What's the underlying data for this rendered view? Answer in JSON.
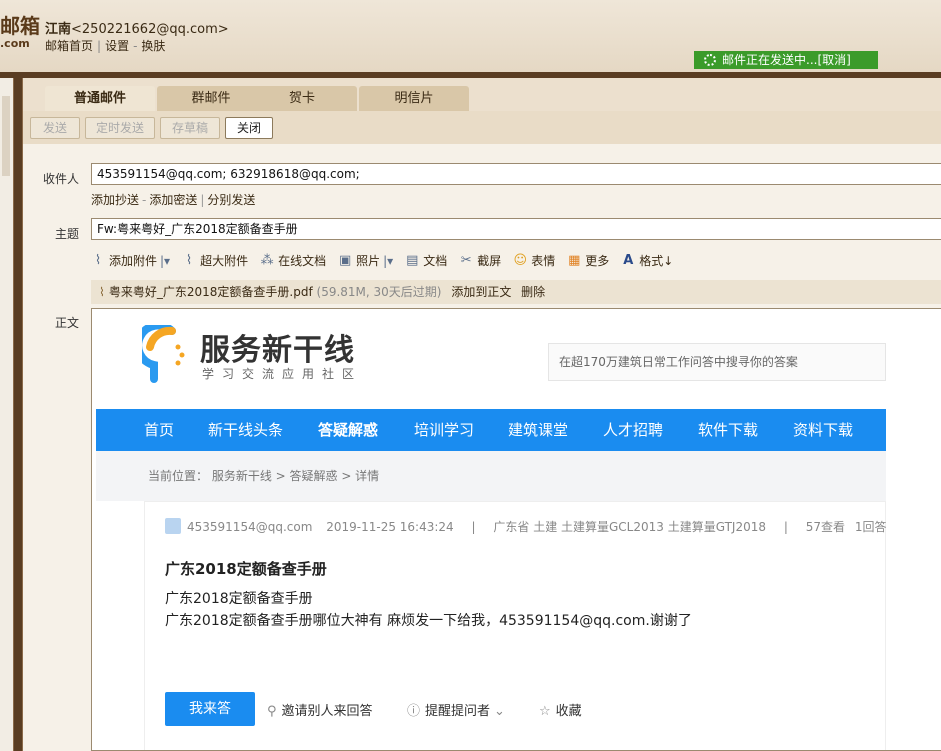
{
  "header": {
    "logo_text": "邮箱",
    "logo_sub": ".com",
    "user_name": "江南",
    "user_email": "<250221662@qq.com>",
    "links": [
      "邮箱首页",
      "设置",
      "换肤"
    ],
    "sending_status": "邮件正在发送中...",
    "cancel_label": "[取消]"
  },
  "tabs": [
    "普通邮件",
    "群邮件",
    "贺卡",
    "明信片"
  ],
  "toolbar_buttons": [
    "发送",
    "定时发送",
    "存草稿",
    "关闭"
  ],
  "compose": {
    "to_label": "收件人",
    "to_value": "453591154@qq.com; 632918618@qq.com;",
    "to_links": [
      "添加抄送",
      "添加密送",
      "分别发送"
    ],
    "subject_label": "主题",
    "subject_value": "Fw:粤来粤好_广东2018定额备查手册",
    "tools": [
      "添加附件",
      "超大附件",
      "在线文档",
      "照片",
      "文档",
      "截屏",
      "表情",
      "更多",
      "格式↓"
    ],
    "attachment": {
      "name": "粤来粤好_广东2018定额备查手册.pdf",
      "meta": "(59.81M, 30天后过期)",
      "add_label": "添加到正文",
      "delete_label": "删除"
    },
    "body_label": "正文"
  },
  "site": {
    "title": "服务新干线",
    "subtitle": "学习交流应用社区",
    "search_placeholder": "在超170万建筑日常工作问答中搜寻你的答案",
    "nav": [
      "首页",
      "新干线头条",
      "答疑解惑",
      "培训学习",
      "建筑课堂",
      "人才招聘",
      "软件下载",
      "资料下载"
    ],
    "breadcrumb": "当前位置：  服务新干线 > 答疑解惑 > 详情",
    "question": {
      "author": "453591154@qq.com",
      "date": "2019-11-25 16:43:24",
      "sep": "|",
      "tags": "广东省  土建 土建算量GCL2013 土建算量GTJ2018",
      "views": "57查看",
      "answers": "1回答",
      "title": "广东2018定额备查手册",
      "body_line1": "广东2018定额备查手册",
      "body_line2": "广东2018定额备查手册哪位大神有 麻烦发一下给我，453591154@qq.com.谢谢了",
      "answer_button": "我来答",
      "invite": "邀请别人来回答",
      "remind": "提醒提问者",
      "favorite": "收藏"
    }
  },
  "colors": {
    "nav_blue": "#1a8cf0",
    "status_green": "#3b9b2a",
    "frame_brown": "#5a3d22"
  }
}
